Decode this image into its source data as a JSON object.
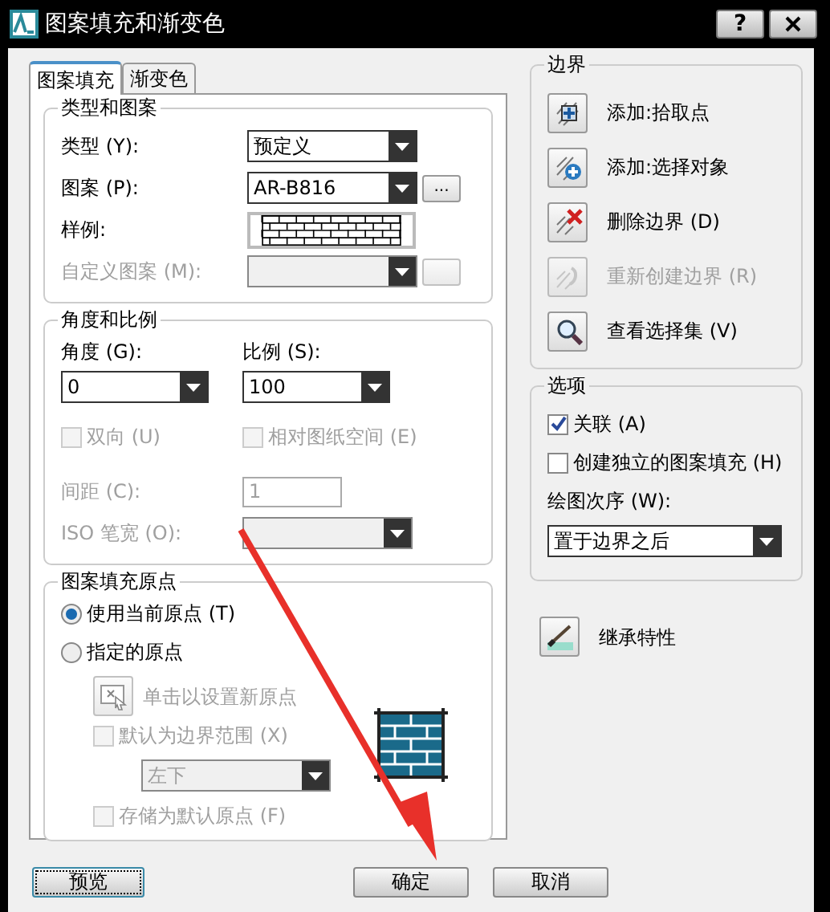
{
  "window": {
    "title": "图案填充和渐变色",
    "help_button": "?"
  },
  "tabs": [
    {
      "label": "图案填充",
      "selected": true
    },
    {
      "label": "渐变色",
      "selected": false
    }
  ],
  "type_and_pattern": {
    "title": "类型和图案",
    "rows": [
      {
        "kind": "dropdown",
        "label": "类型 (Y):",
        "value": "预定义",
        "disabled": false
      },
      {
        "kind": "browse",
        "label": "图案 (P):",
        "value": "AR-B816",
        "button": "...",
        "disabled": false
      },
      {
        "kind": "swatch",
        "label": "样例:",
        "disabled": false
      },
      {
        "kind": "browse",
        "label": "自定义图案 (M):",
        "disabled": true
      }
    ]
  },
  "angle_scale": {
    "title": "角度和比例",
    "angle": {
      "label": "角度 (G):",
      "value": "0"
    },
    "scale": {
      "label": "比例 (S):",
      "value": "100"
    },
    "double": {
      "label": "双向 (U)",
      "checked": false,
      "disabled": true
    },
    "relative": {
      "label": "相对图纸空间 (E)",
      "checked": false,
      "disabled": true
    },
    "spacing": {
      "label": "间距 (C):",
      "value": "1",
      "disabled": true
    },
    "iso_pen": {
      "label": "ISO 笔宽 (O):",
      "disabled": true
    }
  },
  "origin": {
    "title": "图案填充原点",
    "options": [
      {
        "label": "使用当前原点 (T)",
        "selected": true
      },
      {
        "label": "指定的原点",
        "selected": false
      }
    ],
    "click_set": {
      "label": "单击以设置新原点",
      "disabled": true
    },
    "default_extent": {
      "label": "默认为边界范围 (X)",
      "checked": false,
      "disabled": true
    },
    "position": {
      "value": "左下",
      "disabled": true
    },
    "store_default": {
      "label": "存储为默认原点 (F)",
      "checked": false,
      "disabled": true
    }
  },
  "boundaries": {
    "title": "边界",
    "items": [
      {
        "kind": "pick",
        "label": "添加:拾取点",
        "disabled": false
      },
      {
        "kind": "select",
        "label": "添加:选择对象",
        "disabled": false
      },
      {
        "kind": "remove",
        "label": "删除边界 (D)",
        "disabled": false
      },
      {
        "kind": "recreate",
        "label": "重新创建边界 (R)",
        "disabled": true
      },
      {
        "kind": "view",
        "label": "查看选择集 (V)",
        "disabled": false
      }
    ]
  },
  "options": {
    "title": "选项",
    "associative": {
      "label": "关联 (A)",
      "checked": true
    },
    "independent": {
      "label": "创建独立的图案填充 (H)",
      "checked": false
    },
    "draw_order": {
      "label": "绘图次序 (W):",
      "value": "置于边界之后"
    }
  },
  "inherit": {
    "label": "继承特性"
  },
  "buttons": [
    {
      "label": "预览",
      "focused": true
    },
    {
      "label": "确定",
      "focused": false
    },
    {
      "label": "取消",
      "focused": false
    }
  ],
  "annotation": {
    "kind": "arrow"
  }
}
